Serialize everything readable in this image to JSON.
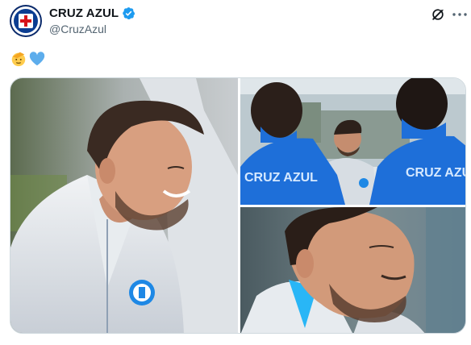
{
  "author": {
    "display_name": "CRUZ AZUL",
    "handle": "@CruzAzul",
    "avatar_icon": "cruz-azul-crest-icon",
    "verified_icon": "verified-badge-icon",
    "verified_color": "#1d9bf0"
  },
  "actions": {
    "grok_icon": "grok-icon",
    "more_icon": "more-options-icon"
  },
  "tweet": {
    "emojis": [
      "saluting-face-emoji",
      "blue-heart-emoji"
    ]
  },
  "media": {
    "photo_count": 3,
    "photos": [
      {
        "name": "coach-smiling-photo",
        "shirt_text": ""
      },
      {
        "name": "coach-team-huddle-photo",
        "shirt_text_left": "CRUZ AZUL",
        "shirt_text_right": "CRUZ AZUL"
      },
      {
        "name": "coach-closeup-photo"
      }
    ]
  },
  "colors": {
    "text_primary": "#0f1419",
    "text_secondary": "#536471",
    "border": "#cfd9de",
    "club_blue": "#0b3d91"
  }
}
